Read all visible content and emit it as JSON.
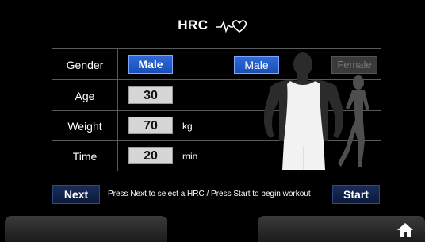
{
  "header": {
    "title": "HRC",
    "heart_icon": "heart-pulse-icon"
  },
  "form": {
    "gender": {
      "label": "Gender",
      "value": "Male"
    },
    "age": {
      "label": "Age",
      "value": "30"
    },
    "weight": {
      "label": "Weight",
      "value": "70",
      "unit": "kg"
    },
    "time": {
      "label": "Time",
      "value": "20",
      "unit": "min"
    }
  },
  "gender_toggle": {
    "male": "Male",
    "female": "Female"
  },
  "actions": {
    "next": "Next",
    "start": "Start",
    "hint": "Press Next to select a HRC  /  Press Start to begin workout"
  },
  "footer": {
    "home_icon": "home-icon"
  },
  "colors": {
    "accent_blue": "#2a62cf",
    "background": "#000000",
    "value_box": "#d6d6d6"
  }
}
